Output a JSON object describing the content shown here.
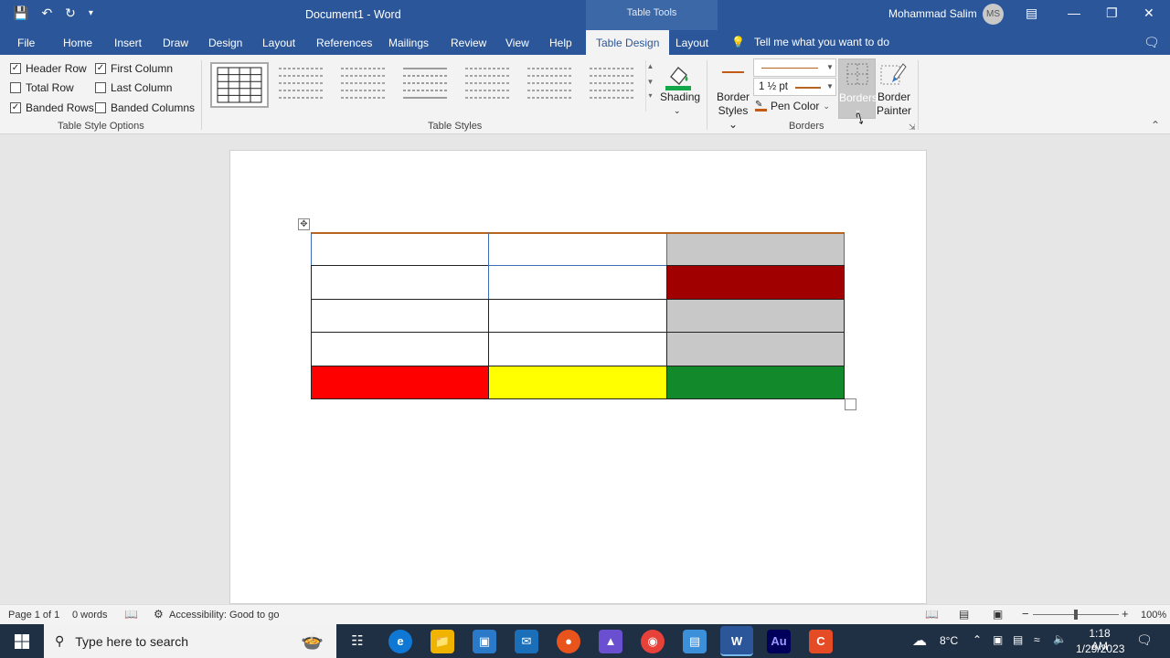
{
  "titlebar": {
    "doc_title": "Document1  -  Word",
    "context_band": "Table Tools",
    "user_name": "Mohammad Salim",
    "user_initials": "MS"
  },
  "tabs": [
    "File",
    "Home",
    "Insert",
    "Draw",
    "Design",
    "Layout",
    "References",
    "Mailings",
    "Review",
    "View",
    "Help",
    "Table Design",
    "Layout"
  ],
  "active_tab": "Table Design",
  "tell_me": "Tell me what you want to do",
  "table_style_options": {
    "header_row": {
      "label": "Header Row",
      "checked": true
    },
    "total_row": {
      "label": "Total Row",
      "checked": false
    },
    "banded_rows": {
      "label": "Banded Rows",
      "checked": true
    },
    "first_column": {
      "label": "First Column",
      "checked": true
    },
    "last_column": {
      "label": "Last Column",
      "checked": false
    },
    "banded_columns": {
      "label": "Banded Columns",
      "checked": false
    },
    "group_label": "Table Style Options"
  },
  "table_styles": {
    "group_label": "Table Styles",
    "shading_label": "Shading"
  },
  "borders": {
    "border_styles_line1": "Border",
    "border_styles_line2": "Styles",
    "pen_weight": "1 ½ pt",
    "pen_color": "Pen Color",
    "borders_label": "Borders",
    "painter_line1": "Border",
    "painter_line2": "Painter",
    "group_label": "Borders"
  },
  "document_table": {
    "rows": 5,
    "cols": 3,
    "cell_fills": [
      [
        "#ffffff",
        "#ffffff",
        "#c8c8c8"
      ],
      [
        "#ffffff",
        "#ffffff",
        "#a00000"
      ],
      [
        "#ffffff",
        "#ffffff",
        "#c8c8c8"
      ],
      [
        "#ffffff",
        "#ffffff",
        "#c8c8c8"
      ],
      [
        "#ff0000",
        "#ffff00",
        "#128a2c"
      ]
    ]
  },
  "statusbar": {
    "page": "Page 1 of 1",
    "words": "0 words",
    "accessibility": "Accessibility: Good to go",
    "zoom": "100%"
  },
  "taskbar": {
    "search_placeholder": "Type here to search",
    "temperature": "8°C",
    "time": "1:18 AM",
    "date": "1/29/2023"
  },
  "colors": {
    "word_blue": "#2b579a",
    "ribbon_bg": "#f3f3f3"
  }
}
